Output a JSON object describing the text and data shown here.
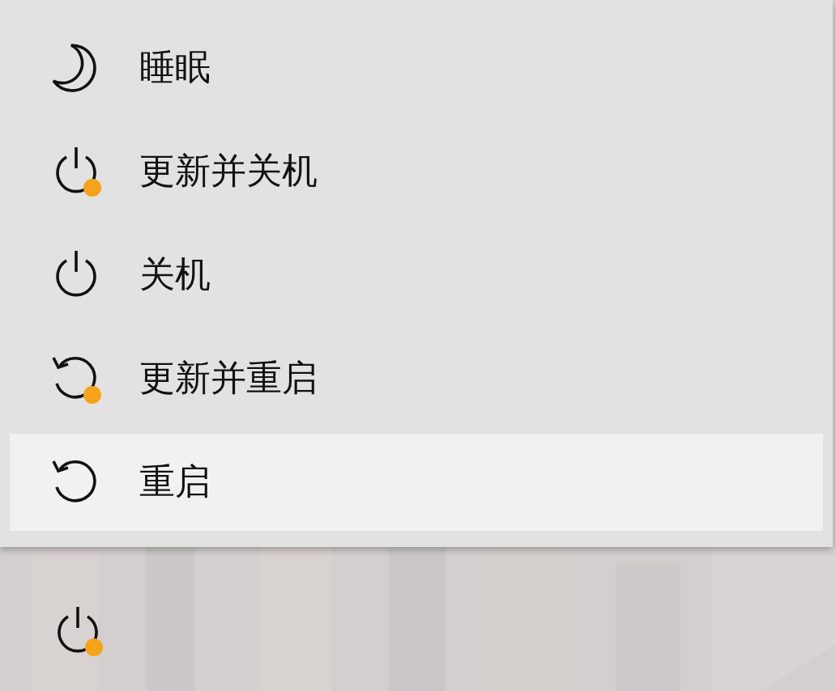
{
  "power_menu": {
    "items": [
      {
        "kind": "sleep",
        "label": "睡眠",
        "update_pending": false,
        "highlighted": false
      },
      {
        "kind": "shutdown",
        "label": "更新并关机",
        "update_pending": true,
        "highlighted": false
      },
      {
        "kind": "shutdown",
        "label": "关机",
        "update_pending": false,
        "highlighted": false
      },
      {
        "kind": "restart",
        "label": "更新并重启",
        "update_pending": true,
        "highlighted": false
      },
      {
        "kind": "restart",
        "label": "重启",
        "update_pending": false,
        "highlighted": true
      }
    ]
  },
  "power_button": {
    "kind": "shutdown",
    "update_pending": true
  }
}
